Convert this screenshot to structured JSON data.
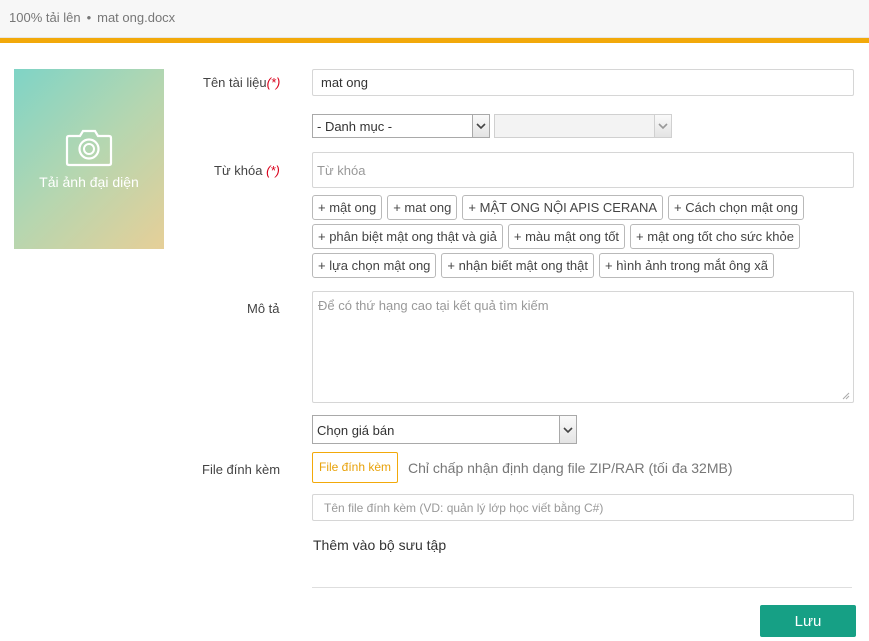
{
  "header": {
    "progress_text": "100% tải lên",
    "separator": "•",
    "file_name": "mat ong.docx",
    "accent_color": "#f2a90a"
  },
  "avatar": {
    "icon": "camera-icon",
    "caption": "Tải ảnh đại diện"
  },
  "form": {
    "title_label": "Tên tài liệu",
    "title_required": "(*)",
    "title_value": "mat ong",
    "category_select": "- Danh mục -",
    "subcategory_select": "",
    "keyword_label": "Từ khóa",
    "keyword_required": "(*)",
    "keyword_placeholder": "Từ khóa",
    "tags": [
      [
        "+ mật ong",
        "+ mat ong",
        "+ MẬT ONG NỘI APIS CERANA",
        "+ Cách chọn mật ong"
      ],
      [
        "+  phân biệt mật ong thật và giả",
        "+  màu mật ong tốt",
        "+  mật ong tốt cho sức khỏe"
      ],
      [
        "+  lựa chọn mật ong",
        "+ nhận biết mật ong thật",
        "+  hình ảnh trong mắt ông xã"
      ]
    ],
    "description_label": "Mô tả",
    "description_placeholder": "Để có thứ hạng cao tại kết quả tìm kiếm",
    "price_select": "Chọn giá bán",
    "attachment_label": "File đính kèm",
    "attachment_button": "File đính kèm",
    "attachment_note": "Chỉ chấp nhận định dạng file ZIP/RAR (tối đa 32MB)",
    "attachment_name_placeholder": "Tên file đính kèm (VD: quản lý lớp học viết bằng C#)",
    "collection_title": "Thêm vào bộ sưu tập",
    "save_button": "Lưu",
    "save_color": "#16a085"
  }
}
